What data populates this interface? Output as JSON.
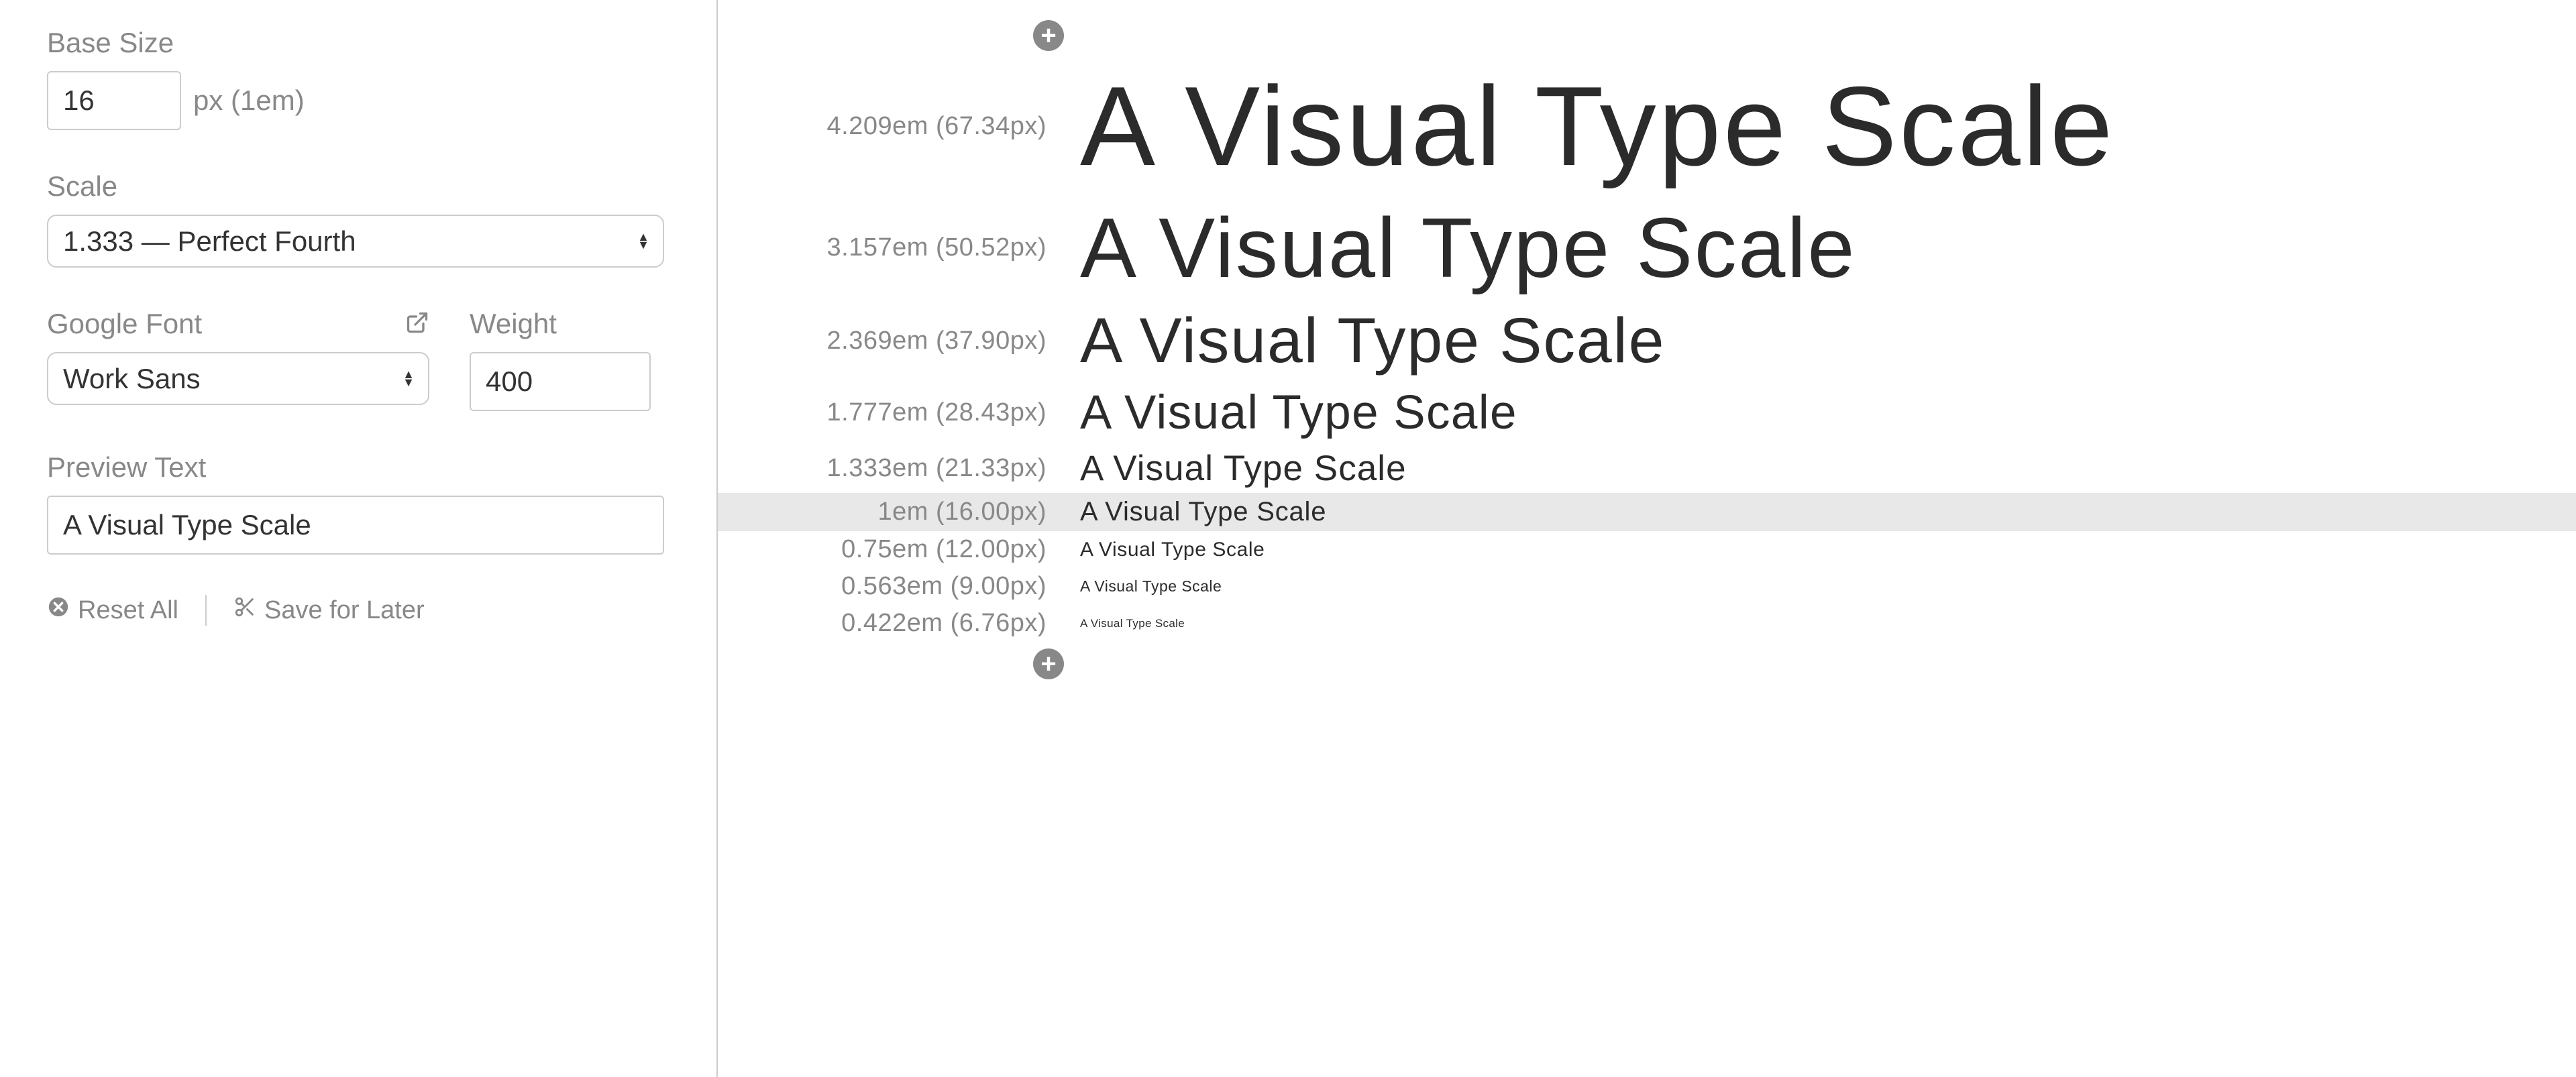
{
  "sidebar": {
    "base_size": {
      "label": "Base Size",
      "value": "16",
      "suffix": "px (1em)"
    },
    "scale": {
      "label": "Scale",
      "selected": "1.333 — Perfect Fourth"
    },
    "font": {
      "label": "Google Font",
      "selected": "Work Sans"
    },
    "weight": {
      "label": "Weight",
      "value": "400"
    },
    "preview": {
      "label": "Preview Text",
      "value": "A Visual Type Scale"
    },
    "reset_label": "Reset All",
    "save_label": "Save for Later"
  },
  "scale_rows": [
    {
      "em": "4.209em",
      "px": "67.34px",
      "text": "A Visual Type Scale",
      "fontSize": 168,
      "base": false
    },
    {
      "em": "3.157em",
      "px": "50.52px",
      "text": "A Visual Type Scale",
      "fontSize": 126,
      "base": false
    },
    {
      "em": "2.369em",
      "px": "37.90px",
      "text": "A Visual Type Scale",
      "fontSize": 95,
      "base": false
    },
    {
      "em": "1.777em",
      "px": "28.43px",
      "text": "A Visual Type Scale",
      "fontSize": 71,
      "base": false
    },
    {
      "em": "1.333em",
      "px": "21.33px",
      "text": "A Visual Type Scale",
      "fontSize": 53,
      "base": false
    },
    {
      "em": "1em",
      "px": "16.00px",
      "text": "A Visual Type Scale",
      "fontSize": 40,
      "base": true
    },
    {
      "em": "0.75em",
      "px": "12.00px",
      "text": "A Visual Type Scale",
      "fontSize": 30,
      "base": false
    },
    {
      "em": "0.563em",
      "px": "9.00px",
      "text": "A Visual Type Scale",
      "fontSize": 23,
      "base": false
    },
    {
      "em": "0.422em",
      "px": "6.76px",
      "text": "A Visual Type Scale",
      "fontSize": 17,
      "base": false
    }
  ]
}
